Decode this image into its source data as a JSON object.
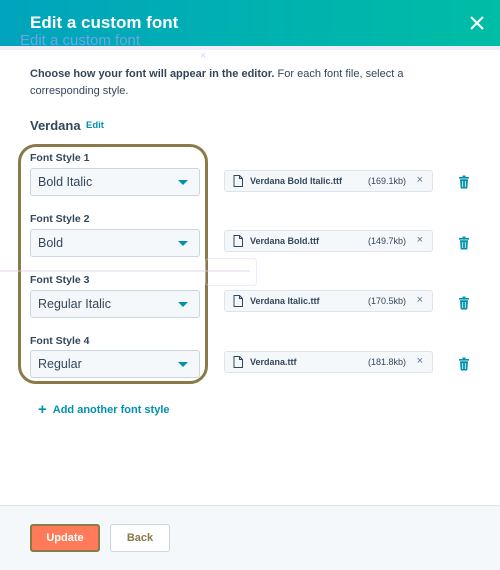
{
  "modal": {
    "title": "Edit a custom font",
    "title_ghost": "Edit a custom font"
  },
  "intro": {
    "bold": "Choose how your font will appear in the editor.",
    "rest": " For each font file, select a corresponding style."
  },
  "font": {
    "name": "Verdana",
    "edit_label": "Edit"
  },
  "styles": [
    {
      "label": "Font Style 1",
      "value": "Bold Italic",
      "file": "Verdana Bold Italic.ttf",
      "size": "(169.1kb)"
    },
    {
      "label": "Font Style 2",
      "value": "Bold",
      "file": "Verdana Bold.ttf",
      "size": "(149.7kb)"
    },
    {
      "label": "Font Style 3",
      "value": "Regular Italic",
      "file": "Verdana Italic.ttf",
      "size": "(170.5kb)"
    },
    {
      "label": "Font Style 4",
      "value": "Regular",
      "file": "Verdana.ttf",
      "size": "(181.8kb)"
    }
  ],
  "add_style_label": "Add another font style",
  "footer": {
    "update_label": "Update",
    "back_label": "Back"
  },
  "colors": {
    "header_start": "#00a4bd",
    "header_end": "#00bda5",
    "link": "#0091ae",
    "primary_button": "#ff7a59",
    "annotation": "#8a7a48"
  },
  "icons": {
    "close": "close-icon",
    "file": "file-icon",
    "trash": "trash-icon",
    "caret": "chevron-down-icon",
    "plus": "plus-icon"
  }
}
